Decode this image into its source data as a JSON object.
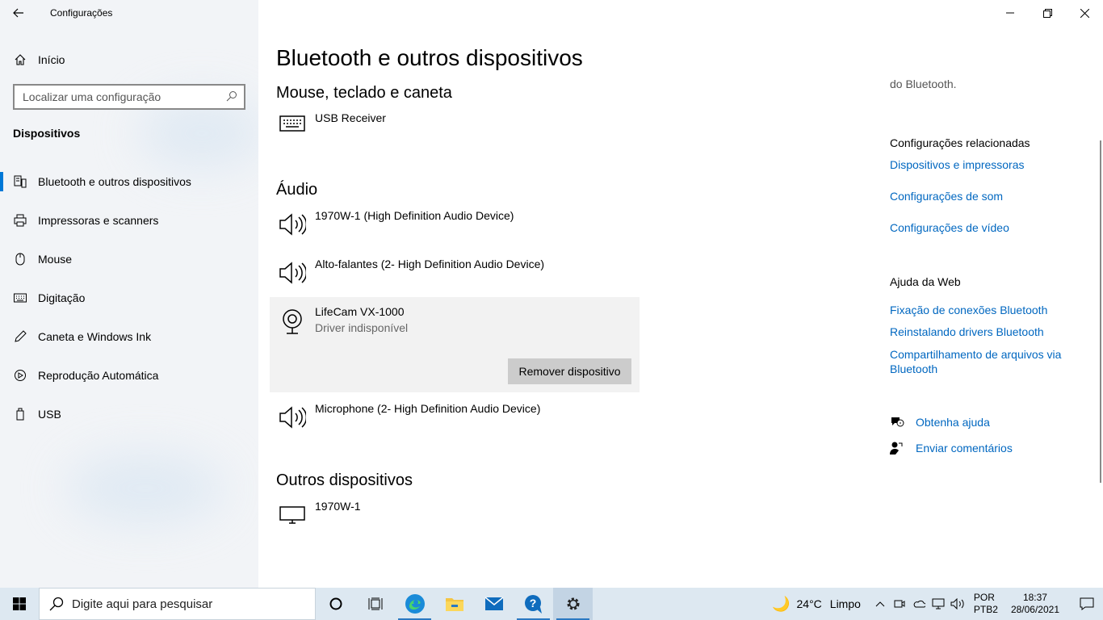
{
  "window": {
    "title": "Configurações",
    "controls": [
      "minimize",
      "restore",
      "close"
    ]
  },
  "sidebar": {
    "home_label": "Início",
    "search_placeholder": "Localizar uma configuração",
    "section_title": "Dispositivos",
    "items": [
      {
        "label": "Bluetooth e outros dispositivos",
        "icon": "bluetooth-devices-icon",
        "active": true
      },
      {
        "label": "Impressoras e scanners",
        "icon": "printer-icon"
      },
      {
        "label": "Mouse",
        "icon": "mouse-icon"
      },
      {
        "label": "Digitação",
        "icon": "keyboard-icon"
      },
      {
        "label": "Caneta e Windows Ink",
        "icon": "pen-icon"
      },
      {
        "label": "Reprodução Automática",
        "icon": "autoplay-icon"
      },
      {
        "label": "USB",
        "icon": "usb-icon"
      }
    ]
  },
  "main": {
    "page_title": "Bluetooth e outros dispositivos",
    "groups": {
      "input": {
        "title": "Mouse, teclado e caneta",
        "devices": [
          {
            "name": "USB Receiver",
            "icon": "keyboard-icon"
          }
        ]
      },
      "audio": {
        "title": "Áudio",
        "devices": [
          {
            "name": "1970W-1 (High Definition Audio Device)",
            "icon": "speaker-icon"
          },
          {
            "name": "Alto-falantes (2- High Definition Audio Device)",
            "icon": "speaker-icon"
          },
          {
            "name": "LifeCam VX-1000",
            "status": "Driver indisponível",
            "icon": "webcam-icon",
            "selected": true
          },
          {
            "name": "Microphone (2- High Definition Audio Device)",
            "icon": "speaker-icon"
          }
        ],
        "remove_button": "Remover dispositivo"
      },
      "other": {
        "title": "Outros dispositivos",
        "devices": [
          {
            "name": "1970W-1",
            "icon": "monitor-icon"
          }
        ]
      }
    }
  },
  "right": {
    "partial_text": "do Bluetooth.",
    "related_title": "Configurações relacionadas",
    "related_links": [
      "Dispositivos e impressoras",
      "Configurações de som",
      "Configurações de vídeo"
    ],
    "web_help_title": "Ajuda da Web",
    "web_links": [
      "Fixação de conexões Bluetooth",
      "Reinstalando drivers Bluetooth",
      "Compartilhamento de arquivos via Bluetooth"
    ],
    "get_help": "Obtenha ajuda",
    "feedback": "Enviar comentários"
  },
  "taskbar": {
    "search_placeholder": "Digite aqui para pesquisar",
    "apps": [
      "cortana-icon",
      "task-view-icon",
      "edge-icon",
      "file-explorer-icon",
      "mail-icon",
      "get-help-app-icon",
      "settings-app-icon"
    ],
    "weather_temp": "24°C",
    "weather_text": "Limpo",
    "lang_1": "POR",
    "lang_2": "PTB2",
    "time": "18:37",
    "date": "28/06/2021"
  },
  "colors": {
    "accent": "#0078d7",
    "link": "#0067c0",
    "taskbar": "#dde8f1",
    "sidebar": "#f2f4f7"
  }
}
